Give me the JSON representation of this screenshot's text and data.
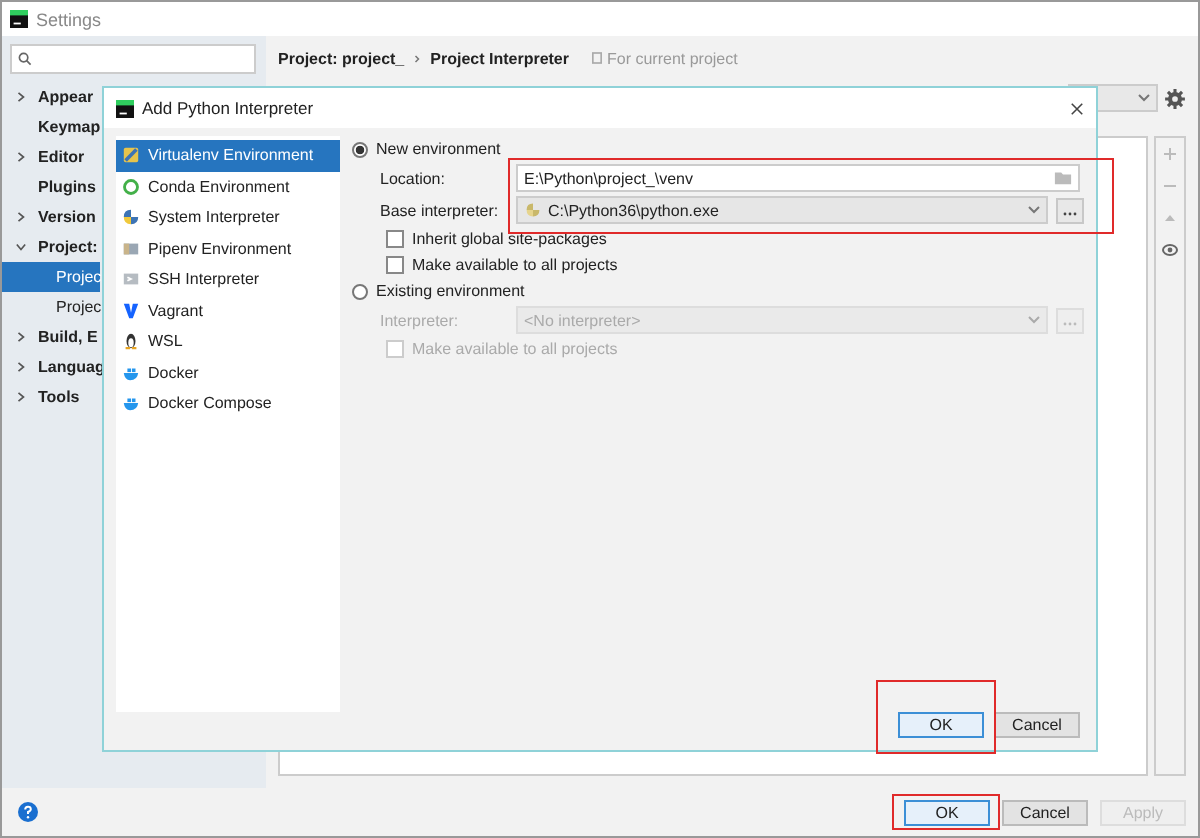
{
  "settings_window": {
    "title": "Settings",
    "sidebar": {
      "items": [
        {
          "label": "Appear",
          "kind": "group",
          "expanded": false
        },
        {
          "label": "Keymap",
          "kind": "leaf"
        },
        {
          "label": "Editor",
          "kind": "group",
          "expanded": false
        },
        {
          "label": "Plugins",
          "kind": "leaf"
        },
        {
          "label": "Version",
          "kind": "group",
          "expanded": false
        },
        {
          "label": "Project:",
          "kind": "group",
          "expanded": true,
          "children": [
            {
              "label": "Projec",
              "selected": true
            },
            {
              "label": "Projec",
              "selected": false
            }
          ]
        },
        {
          "label": "Build, E",
          "kind": "group",
          "expanded": false
        },
        {
          "label": "Languag",
          "kind": "group",
          "expanded": false
        },
        {
          "label": "Tools",
          "kind": "group",
          "expanded": false
        }
      ]
    },
    "breadcrumb": [
      "Project: project_",
      "Project Interpreter"
    ],
    "scope": "For current project",
    "buttons": [
      {
        "label": "OK",
        "kind": "default",
        "disabled": false
      },
      {
        "label": "Cancel",
        "kind": "normal",
        "disabled": false
      },
      {
        "label": "Apply",
        "kind": "normal",
        "disabled": true
      }
    ]
  },
  "dialog": {
    "title": "Add Python Interpreter",
    "interpreter_types": [
      {
        "label": "Virtualenv Environment",
        "selected": true
      },
      {
        "label": "Conda Environment",
        "selected": false
      },
      {
        "label": "System Interpreter",
        "selected": false
      },
      {
        "label": "Pipenv Environment",
        "selected": false
      },
      {
        "label": "SSH Interpreter",
        "selected": false
      },
      {
        "label": "Vagrant",
        "selected": false
      },
      {
        "label": "WSL",
        "selected": false
      },
      {
        "label": "Docker",
        "selected": false
      },
      {
        "label": "Docker Compose",
        "selected": false
      }
    ],
    "new_environment": {
      "label": "New environment",
      "selected": true,
      "location": {
        "label": "Location:",
        "value": "E:\\Python\\project_\\venv"
      },
      "base_interpreter": {
        "label": "Base interpreter:",
        "value": "C:\\Python36\\python.exe"
      },
      "options": [
        {
          "label": "Inherit global site-packages",
          "checked": false
        },
        {
          "label": "Make available to all projects",
          "checked": false
        }
      ]
    },
    "existing_environment": {
      "label": "Existing environment",
      "selected": false,
      "interpreter": {
        "label": "Interpreter:",
        "value": "<No interpreter>"
      },
      "options": [
        {
          "label": "Make available to all projects",
          "checked": false
        }
      ]
    },
    "buttons": [
      {
        "label": "OK",
        "kind": "default"
      },
      {
        "label": "Cancel",
        "kind": "normal"
      }
    ]
  }
}
